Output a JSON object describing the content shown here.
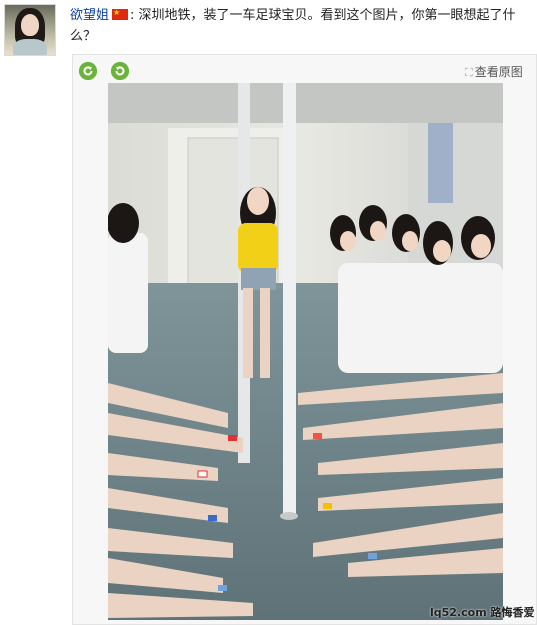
{
  "post": {
    "author": "欲望姐",
    "content": ": 深圳地铁，装了一车足球宝贝。看到这个图片，你第一眼想起了什么？"
  },
  "toolbar": {
    "rotate_left_icon": "rotate-left-icon",
    "rotate_right_icon": "rotate-right-icon",
    "view_original_label": "查看原图"
  },
  "photo": {
    "watermark": "lq52.com 路悔香爱"
  },
  "colors": {
    "author_link": "#0a3ea6",
    "tool_green": "#6bb43b"
  }
}
